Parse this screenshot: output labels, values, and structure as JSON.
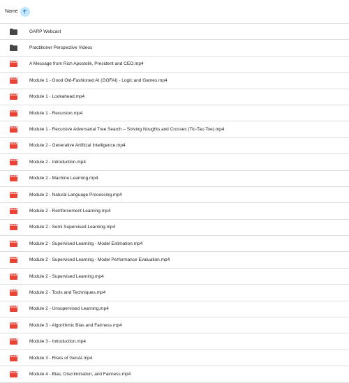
{
  "header": {
    "name_label": "Name",
    "sort_icon": "arrow-upward-icon"
  },
  "colors": {
    "folder": "#444746",
    "video": "#ea4335",
    "sort_bg": "#c2e7ff",
    "sort_arrow": "#0b57d0",
    "divider": "#dadce0"
  },
  "items": [
    {
      "type": "folder",
      "name": "GARP Webcast"
    },
    {
      "type": "folder",
      "name": "Practitioner Perspective Videos"
    },
    {
      "type": "video",
      "name": "A Message from Rich Apostolik, President and CEO.mp4"
    },
    {
      "type": "video",
      "name": "Module 1 - Good Old-Fashioned AI (GOFAI) - Logic and Games.mp4"
    },
    {
      "type": "video",
      "name": "Module 1 - Lookahead.mp4"
    },
    {
      "type": "video",
      "name": "Module 1 - Recursion.mp4"
    },
    {
      "type": "video",
      "name": "Module 1 - Recursive Adversarial Tree Search – Solving Noughts and Crosses (Tic-Tac-Toe).mp4"
    },
    {
      "type": "video",
      "name": "Module 2 - Generative Artificial Intelligence.mp4"
    },
    {
      "type": "video",
      "name": "Module 2 - Introduction.mp4"
    },
    {
      "type": "video",
      "name": "Module 2 - Machine Learning.mp4"
    },
    {
      "type": "video",
      "name": "Module 2 - Natural Language Processing.mp4"
    },
    {
      "type": "video",
      "name": "Module 2 - Reinforcement Learning.mp4"
    },
    {
      "type": "video",
      "name": "Module 2 - Semi Supervised Learning.mp4"
    },
    {
      "type": "video",
      "name": "Module 2 - Supervised Learning - Model Estimation.mp4"
    },
    {
      "type": "video",
      "name": "Module 2 - Supervised Learning - Model Performance Evaluation.mp4"
    },
    {
      "type": "video",
      "name": "Module 2 - Supervised Learning.mp4"
    },
    {
      "type": "video",
      "name": "Module 2 - Tools and Techniques.mp4"
    },
    {
      "type": "video",
      "name": "Module 2 - Unsupervised Learning.mp4"
    },
    {
      "type": "video",
      "name": "Module 3 - Algorithmic Bias and Fairness.mp4"
    },
    {
      "type": "video",
      "name": "Module 3 - Introduction.mp4"
    },
    {
      "type": "video",
      "name": "Module 3 - Risks of GenAI.mp4"
    },
    {
      "type": "video",
      "name": "Module 4 - Bias, Discrimination, and Fairness.mp4"
    }
  ]
}
